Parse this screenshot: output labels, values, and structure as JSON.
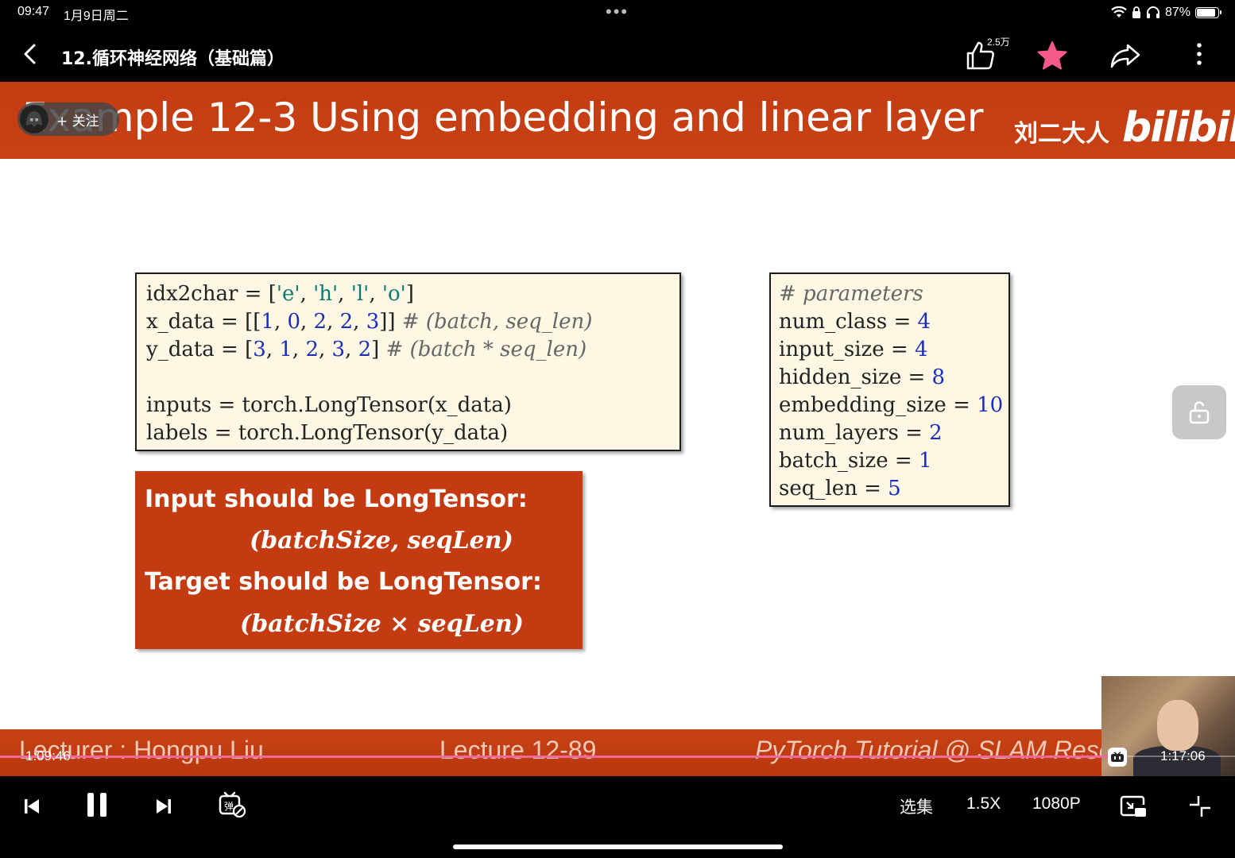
{
  "status": {
    "time": "09:47",
    "date": "1月9日周二",
    "battery": "87%",
    "battery_level": 0.87
  },
  "nav": {
    "title": "12.循环神经网络（基础篇）",
    "like_count": "2.5万"
  },
  "slide": {
    "title": "Example 12-3 Using embedding and linear layer",
    "uploader": "刘二大人",
    "logo": "bilibili",
    "follow_label": "+ 关注",
    "code_left": {
      "line1": {
        "var": "idx2char",
        "eq": " = ",
        "lb": "[",
        "s1": "'e'",
        "c1": ", ",
        "s2": "'h'",
        "c2": ", ",
        "s3": "'l'",
        "c3": ", ",
        "s4": "'o'",
        "rb": "]"
      },
      "line2": {
        "var": "x_data",
        "eq": " = ",
        "lb": "[[",
        "n1": "1",
        "c1": ", ",
        "n2": "0",
        "c2": ", ",
        "n3": "2",
        "c3": ", ",
        "n4": "2",
        "c4": ", ",
        "n5": "3",
        "rb": "]] ",
        "comment": "# (batch, seq_len)"
      },
      "line3": {
        "var": "y_data",
        "eq": " = ",
        "lb": "[",
        "n1": "3",
        "c1": ", ",
        "n2": "1",
        "c2": ", ",
        "n3": "2",
        "c3": ", ",
        "n4": "3",
        "c4": ", ",
        "n5": "2",
        "rb": "] ",
        "comment": "# (batch * seq_len)"
      },
      "line4": "inputs = torch.LongTensor(x_data)",
      "line5": "labels = torch.LongTensor(y_data)"
    },
    "code_right": {
      "comment": "# parameters",
      "params": [
        {
          "name": "num_class = ",
          "value": "4"
        },
        {
          "name": "input_size = ",
          "value": "4"
        },
        {
          "name": "hidden_size = ",
          "value": "8"
        },
        {
          "name": "embedding_size = ",
          "value": "10"
        },
        {
          "name": "num_layers = ",
          "value": "2"
        },
        {
          "name": "batch_size = ",
          "value": "1"
        },
        {
          "name": "seq_len = ",
          "value": "5"
        }
      ]
    },
    "red_box": {
      "input_heading": "Input should be LongTensor:",
      "input_formula": "(batchSize, seqLen)",
      "target_heading": "Target should be LongTensor:",
      "target_formula": "(batchSize × seqLen)"
    },
    "footer": {
      "left": "Lecturer : Hongpu Liu",
      "mid": "Lecture 12-89",
      "right": "PyTorch Tutorial @ SLAM Research"
    }
  },
  "player": {
    "current_time": "1:09:46",
    "total_time": "1:17:06",
    "progress": 0.905,
    "episodes_label": "选集",
    "speed_label": "1.5X",
    "quality_label": "1080P"
  }
}
